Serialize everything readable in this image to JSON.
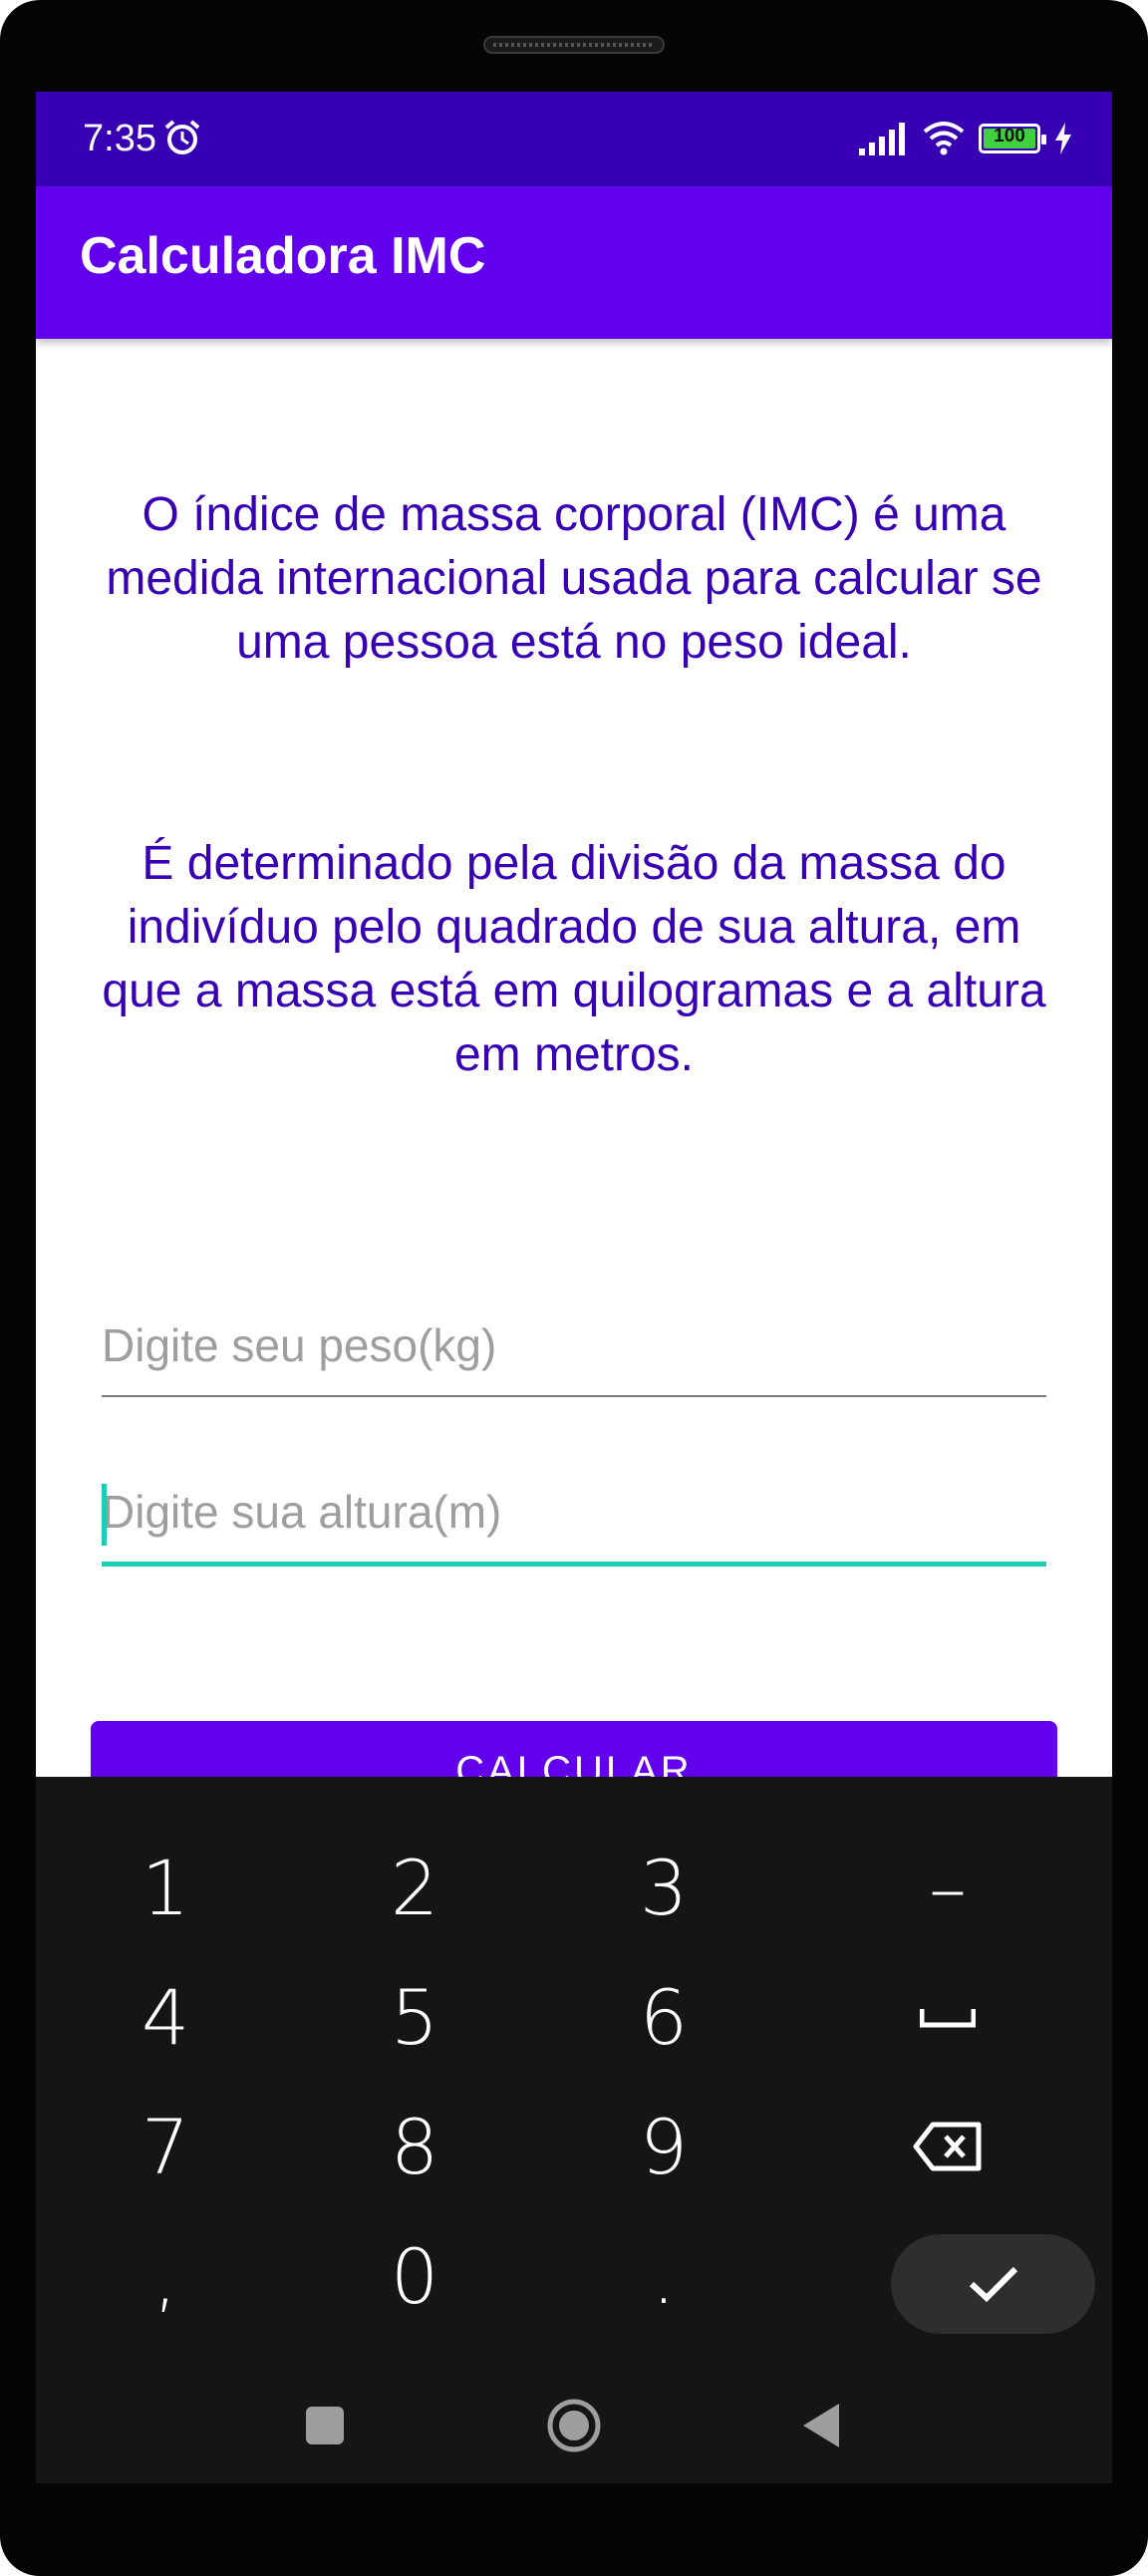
{
  "status_bar": {
    "time": "7:35",
    "battery": "100",
    "icons": [
      "alarm-icon",
      "signal-icon",
      "wifi-icon",
      "battery-icon",
      "charging-icon"
    ]
  },
  "app_bar": {
    "title": "Calculadora IMC"
  },
  "main": {
    "description_1": "O índice de massa corporal (IMC) é uma medida internacional usada para calcular se uma pessoa está no peso ideal.",
    "description_2": "É determinado pela divisão da massa do indivíduo pelo quadrado de sua altura, em que a massa está em quilogramas e a altura em metros.",
    "weight_field": {
      "placeholder": "Digite seu peso(kg)",
      "value": ""
    },
    "height_field": {
      "placeholder": "Digite sua altura(m)",
      "value": ""
    },
    "calculate_button": "CALCULAR"
  },
  "keyboard": {
    "keys": [
      "1",
      "2",
      "3",
      "–",
      "4",
      "5",
      "6",
      "␣",
      "7",
      "8",
      "9",
      "⌫",
      ",",
      "0",
      ".",
      "✓"
    ]
  },
  "colors": {
    "primary": "#6200ee",
    "primary_dark": "#3700b3",
    "accent": "#1ecbb5",
    "keyboard_bg": "#151515"
  }
}
